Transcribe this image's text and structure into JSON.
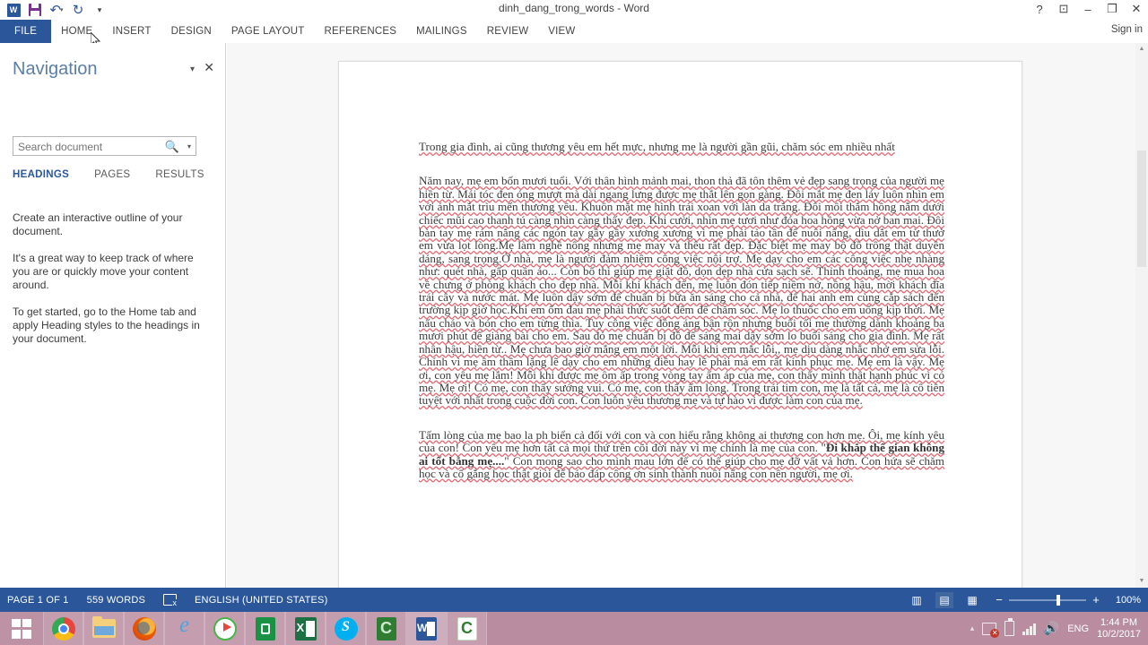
{
  "titlebar": {
    "document_title": "dinh_dang_trong_words - Word",
    "quick_access": [
      {
        "name": "word-logo-icon",
        "label": "W"
      },
      {
        "name": "save-icon",
        "label": "Save"
      },
      {
        "name": "undo-icon",
        "label": "↶"
      },
      {
        "name": "redo-icon",
        "label": "↻"
      },
      {
        "name": "customize-quick-access-icon",
        "label": "▾"
      }
    ],
    "window_controls": {
      "help": "?",
      "ribbon_display_options": "⊡",
      "minimize": "–",
      "restore": "❐",
      "close": "✕"
    }
  },
  "ribbon": {
    "tabs": [
      {
        "label": "FILE",
        "active": true
      },
      {
        "label": "HOME",
        "active": false
      },
      {
        "label": "INSERT",
        "active": false
      },
      {
        "label": "DESIGN",
        "active": false
      },
      {
        "label": "PAGE LAYOUT",
        "active": false
      },
      {
        "label": "REFERENCES",
        "active": false
      },
      {
        "label": "MAILINGS",
        "active": false
      },
      {
        "label": "REVIEW",
        "active": false
      },
      {
        "label": "VIEW",
        "active": false
      }
    ],
    "sign_in": "Sign in"
  },
  "navigation": {
    "title": "Navigation",
    "collapse_caret": "▾",
    "close": "✕",
    "search": {
      "value": "",
      "placeholder": "Search document",
      "search_icon": "search-icon",
      "dropdown_caret": "▾"
    },
    "tabs": [
      {
        "label": "HEADINGS",
        "active": true
      },
      {
        "label": "PAGES",
        "active": false
      },
      {
        "label": "RESULTS",
        "active": false
      }
    ],
    "body": [
      "Create an interactive outline of your document.",
      "It's a great way to keep track of where you are or quickly move your content around.",
      "To get started, go to the Home tab and apply Heading styles to the headings in your document."
    ]
  },
  "document": {
    "paragraphs": [
      {
        "id": "p1",
        "text": "Trong gia đình, ai cũng thương yêu em hết mực, nhưng mẹ là người gần gũi, chăm sóc em nhiều nhất"
      },
      {
        "id": "p2",
        "text": "Năm nay, mẹ em bốn mươi tuổi. Với thân hình mảnh mai, thon thả đã tôn thêm vẻ đẹp sang trọng của người mẹ hiền từ. Mái tóc đen óng mượt mà dài ngang lưng được mẹ thắt lên gọn gàng. Đôi mắt mẹ đen láy luôn nhìn em với ánh mắt trìu mến thương yêu. Khuôn mặt mẹ hình trái xoan với làn da trắng. Đôi môi thắm hồng nằm dưới chiếc mũi cao thanh tú càng nhìn càng thấy đẹp. Khi cười, nhìn mẹ tươi như đóa hoa hồng vừa nở ban mai. Đôi bàn tay mẹ rám nắng các ngón tay gầy gầy xương xương vì mẹ phải tảo tần để nuôi nấng, dìu dắt em từ thưở em vừa lọt lòng.Mẹ làm nghề nông nhưng mẹ may và thêu rất đẹp. Đặc biệt mẹ may bộ đồ trông thật duyên dáng, sang trọng.Ở nhà, mẹ là người đảm nhiệm công việc nội trợ. Mẹ dạy cho em các công việc nhẹ nhàng như: quét nhà, gấp quần áo... Còn bố thì giúp mẹ giặt đồ, dọn dẹp nhà cửa sạch sẽ. Thỉnh thoảng, mẹ mua hoa về chưng ở phòng khách cho đẹp nhà. Mỗi khi khách đến, mẹ luôn đón tiếp niềm nở, nồng hậu, mời khách đĩa trái cây và nước mát. Mẹ luôn dậy sớm để chuẩn bị bữa ăn sáng cho cả nhà, để hai anh em cùng cắp sách đến trường kịp giờ học.Khi em ốm đau mẹ phải thức suốt đêm để chăm sóc. Mẹ lo thuốc cho em uống kịp thời. Mẹ nấu cháo và bón cho em từng thìa. Tuy công việc đồng áng bận rộn nhưng buổi tối mẹ thường dành khoảng ba mươi phút để giảng bài cho em. Sau đó mẹ chuẩn bị đồ để sáng mai dậy sớm lo buổi sáng cho gia đình. Mẹ rất nhân hậu, hiền từ.. Mẹ chưa bao giờ mắng em một lời. Mỗi khi em mắc lỗi,, mẹ dịu dàng nhắc nhở em sửa lỗi. Chính vì mẹ âm thầm lặng lẽ dạy cho em những điều hay lẽ phải mà em rất kính phục mẹ. Mẹ em là vậy. Mẹ ơi, con yêu mẹ lắm! Mỗi khi được mẹ ôm ấp trong vòng tay ấm áp của mẹ, con thấy mình thật hạnh phúc vì có mẹ. Mẹ ơi! Có mẹ, con thấy sướng vui. Có mẹ, con thấy ấm lòng. Trong trái tim con, mẹ là tất cả, mẹ là cô tiên tuyệt với nhất trong cuộc đời con. Con luôn yêu thương mẹ và tự hào vì được làm con của mẹ."
      },
      {
        "id": "p3",
        "before": "Tấm lòng của mẹ bao la ph biển cả đối với con và con hiểu rằng không ai thương con hơn mẹ. Ôi, mẹ kính yêu của con! Con yêu mẹ hơn tất cả mọi thứ trên cõi đời này vì mẹ chính là mẹ của con. \"",
        "bold": "Đi khắp thế gian không ai tốt bằng mẹ....",
        "after": "\" Con mong sao cho mình mau lớn để có thể giúp cho mẹ đỡ vất vả hơn. Con hứa sẽ chăm học và cố gắng học thật giỏi để báo đáp công ơn sinh thành nuôi nấng con nên người, mẹ ơi."
      }
    ]
  },
  "statusbar": {
    "page_info": "PAGE 1 OF 1",
    "word_count": "559 WORDS",
    "proofing_icon": "proofing-errors-icon",
    "language": "ENGLISH (UNITED STATES)",
    "views": [
      {
        "name": "read-mode-view-button",
        "glyph": "▥",
        "active": false
      },
      {
        "name": "print-layout-view-button",
        "glyph": "▤",
        "active": true
      },
      {
        "name": "web-layout-view-button",
        "glyph": "▦",
        "active": false
      }
    ],
    "zoom": {
      "minus": "−",
      "plus": "+",
      "level": "100%"
    }
  },
  "taskbar": {
    "items": [
      {
        "name": "start-button",
        "icon": "windows-start-icon",
        "state": "start"
      },
      {
        "name": "taskbar-chrome",
        "icon": "chrome-icon",
        "state": "pinned"
      },
      {
        "name": "taskbar-file-explorer",
        "icon": "file-explorer-icon",
        "state": "pinned"
      },
      {
        "name": "taskbar-firefox",
        "icon": "firefox-icon",
        "state": "pinned"
      },
      {
        "name": "taskbar-internet-explorer",
        "icon": "internet-explorer-icon",
        "state": "pinned"
      },
      {
        "name": "taskbar-media-player",
        "icon": "media-player-icon",
        "state": "open"
      },
      {
        "name": "taskbar-store",
        "icon": "store-icon",
        "state": "pinned"
      },
      {
        "name": "taskbar-excel",
        "icon": "excel-icon",
        "state": "open"
      },
      {
        "name": "taskbar-skype",
        "icon": "skype-icon",
        "state": "open"
      },
      {
        "name": "taskbar-coccoc",
        "icon": "coccoc-icon",
        "state": "open"
      },
      {
        "name": "taskbar-word",
        "icon": "word-icon",
        "state": "active"
      },
      {
        "name": "taskbar-coccoc-2",
        "icon": "coccoc-alt-icon",
        "state": "open"
      }
    ],
    "tray": {
      "show_hidden": "▴",
      "network_icon": "network-disconnected-icon",
      "battery_icon": "battery-icon",
      "signal_icon": "signal-bars-icon",
      "volume_icon": "volume-icon",
      "language": "ENG",
      "time": "1:44 PM",
      "date": "10/2/2017"
    }
  },
  "colors": {
    "word_blue": "#2b579a",
    "spell_error_red": "#e36a72",
    "taskbar": "#b98ca0",
    "nav_title": "#5b7fa6"
  }
}
